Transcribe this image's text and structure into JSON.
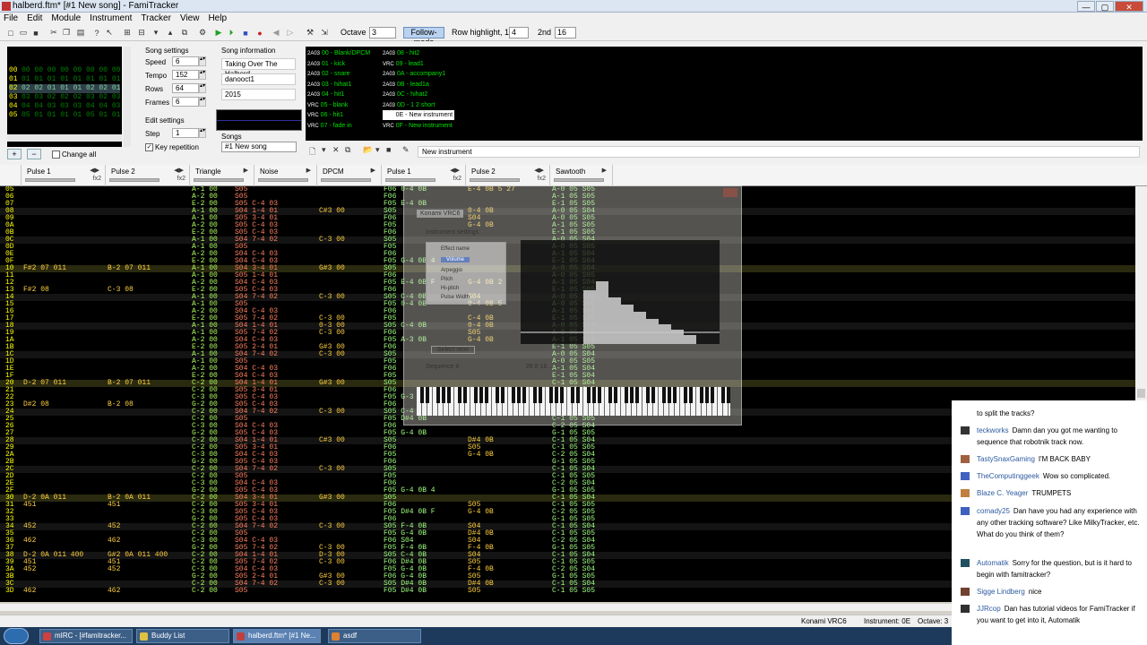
{
  "window": {
    "title": "halberd.ftm* [#1 New song] - FamiTracker"
  },
  "menu": [
    "File",
    "Edit",
    "Module",
    "Instrument",
    "Tracker",
    "View",
    "Help"
  ],
  "toolbar": {
    "octave_label": "Octave",
    "octave_value": "3",
    "follow_mode": "Follow-mode",
    "row_highlight_label": "Row highlight, 1st",
    "row_highlight_1st": "4",
    "second_label": "2nd",
    "row_highlight_2nd": "16"
  },
  "frames": {
    "rows": [
      {
        "n": "00",
        "v": "00 00 00 00 00 00 00 00"
      },
      {
        "n": "01",
        "v": "01 01 01 01 01 01 01 01"
      },
      {
        "n": "02",
        "v": "02 02 01 01 01 02 02 01"
      },
      {
        "n": "03",
        "v": "03 03 02 02 02 03 02 03"
      },
      {
        "n": "04",
        "v": "04 04 03 03 03 04 04 03"
      },
      {
        "n": "05",
        "v": "05 01 01 01 01 05 01 01"
      }
    ],
    "current": 2
  },
  "song_settings": {
    "title": "Song settings",
    "speed_label": "Speed",
    "speed": "6",
    "tempo_label": "Tempo",
    "tempo": "152",
    "rows_label": "Rows",
    "rows": "64",
    "frames_label": "Frames",
    "frames": "6"
  },
  "edit_settings": {
    "title": "Edit settings",
    "step_label": "Step",
    "step": "1",
    "key_repetition": "Key repetition"
  },
  "song_info": {
    "title": "Song information",
    "name": "Taking Over The Halberd",
    "artist": "danooct1",
    "copyright": "2015"
  },
  "songs": {
    "label": "Songs",
    "selected": "#1 New song"
  },
  "instruments": [
    {
      "name": "00 - Blank/DPCM",
      "vrc": false
    },
    {
      "name": "01 - kick",
      "vrc": false
    },
    {
      "name": "02 - snare",
      "vrc": false
    },
    {
      "name": "03 - hihat1",
      "vrc": false
    },
    {
      "name": "04 - hit1",
      "vrc": false
    },
    {
      "name": "05 - blank",
      "vrc": true
    },
    {
      "name": "06 - hit1",
      "vrc": true
    },
    {
      "name": "07 - fade in",
      "vrc": true
    },
    {
      "name": "08 - hit2",
      "vrc": false
    },
    {
      "name": "09 - lead1",
      "vrc": true
    },
    {
      "name": "0A - accompany1",
      "vrc": false
    },
    {
      "name": "0B - lead1a",
      "vrc": false
    },
    {
      "name": "0C - hihat2",
      "vrc": false
    },
    {
      "name": "0D - 1 2 short",
      "vrc": false
    },
    {
      "name": "0E - New instrument",
      "vrc": true,
      "selected": true
    },
    {
      "name": "0F - New instrument",
      "vrc": true
    }
  ],
  "instrument_name_field": "New instrument",
  "change_all": "Change all",
  "channels": [
    {
      "name": "Pulse 1",
      "fx": "fx2"
    },
    {
      "name": "Pulse 2",
      "fx": "fx2"
    },
    {
      "name": "Triangle",
      "fx": ""
    },
    {
      "name": "Noise",
      "fx": ""
    },
    {
      "name": "DPCM",
      "fx": ""
    },
    {
      "name": "Pulse 1",
      "fx": "fx2"
    },
    {
      "name": "Pulse 2",
      "fx": "fx2"
    },
    {
      "name": "Sawtooth",
      "fx": ""
    }
  ],
  "pattern_rows": [
    {
      "r": "05",
      "c": [
        "",
        "",
        "A-1 00",
        "S05",
        "",
        "F06 0-4 0B",
        "E-4 0B 5 27",
        "A-0 05 S05"
      ]
    },
    {
      "r": "06",
      "c": [
        "",
        "",
        "A-2 00",
        "S05",
        "",
        "F06",
        "",
        "A-1 05 S05"
      ]
    },
    {
      "r": "07",
      "c": [
        "",
        "",
        "E-2 00",
        "S05 C-4 03",
        "",
        "F05 E-4 0B",
        "",
        "E-1 05 S05"
      ]
    },
    {
      "r": "08",
      "c": [
        "",
        "",
        "A-1 00",
        "S04 1-4 01",
        "C#3 00",
        "S05",
        "0-4 0B",
        "A-0 05 S04"
      ]
    },
    {
      "r": "09",
      "c": [
        "",
        "",
        "A-1 00",
        "S05 3-4 01",
        "",
        "F06",
        "S04",
        "A-0 05 S05"
      ]
    },
    {
      "r": "0A",
      "c": [
        "",
        "",
        "A-2 00",
        "S05 C-4 03",
        "",
        "F05",
        "G-4 0B",
        "A-1 05 S05"
      ]
    },
    {
      "r": "0B",
      "c": [
        "",
        "",
        "E-2 00",
        "S05 C-4 03",
        "",
        "F06",
        "",
        "E-1 05 S05"
      ]
    },
    {
      "r": "0C",
      "c": [
        "",
        "",
        "A-1 00",
        "S04 7-4 02",
        "C-3 00",
        "S05",
        "",
        "A-0 05 S04"
      ]
    },
    {
      "r": "0D",
      "c": [
        "",
        "",
        "A-1 00",
        "S05",
        "",
        "F05",
        "",
        "A-0 05 S05"
      ]
    },
    {
      "r": "0E",
      "c": [
        "",
        "",
        "A-2 00",
        "S04 C-4 03",
        "",
        "F06",
        "",
        "A-1 05 S04"
      ]
    },
    {
      "r": "0F",
      "c": [
        "",
        "",
        "E-2 00",
        "S04 C-4 03",
        "",
        "F05 G-4 0B 4",
        "",
        "E-1 05 S04"
      ]
    },
    {
      "r": "10",
      "c": [
        "F#2 07 011",
        "B-2 07 011",
        "A-1 00",
        "S04 3-4 01",
        "G#3 00",
        "S05",
        "",
        "A-0 05 S04"
      ]
    },
    {
      "r": "11",
      "c": [
        "",
        "",
        "A-1 00",
        "S05 1-4 01",
        "",
        "F06",
        "",
        "A-0 05 S05"
      ]
    },
    {
      "r": "12",
      "c": [
        "",
        "",
        "A-2 00",
        "S04 C-4 03",
        "",
        "F05 E-4 0B F",
        "G-4 0B 2",
        "A-1 05 S04"
      ]
    },
    {
      "r": "13",
      "c": [
        "F#2 08",
        "C-3 08",
        "E-2 00",
        "S05 C-4 03",
        "",
        "F06",
        "",
        "E-1 05 S05"
      ]
    },
    {
      "r": "14",
      "c": [
        "",
        "",
        "A-1 00",
        "S04 7-4 02",
        "C-3 00",
        "S05 C-4 0B",
        "S04",
        "A-0 05 S04"
      ]
    },
    {
      "r": "15",
      "c": [
        "",
        "",
        "A-1 00",
        "S05",
        "",
        "F05 0-4 0B",
        "0-4 0B 5",
        "A-0 05 S05"
      ]
    },
    {
      "r": "16",
      "c": [
        "",
        "",
        "A-2 00",
        "S04 C-4 03",
        "",
        "F06",
        "",
        "A-1 05 S04"
      ]
    },
    {
      "r": "17",
      "c": [
        "",
        "",
        "E-2 00",
        "S05 7-4 02",
        "C-3 00",
        "F05",
        "C-4 0B",
        "E-1 05 S05"
      ]
    },
    {
      "r": "18",
      "c": [
        "",
        "",
        "A-1 00",
        "S04 1-4 01",
        "0-3 00",
        "S05 C-4 0B",
        "0-4 0B",
        "A-0 05 S04"
      ]
    },
    {
      "r": "19",
      "c": [
        "",
        "",
        "A-1 00",
        "S05 7-4 02",
        "C-3 00",
        "F06",
        "S05",
        "A-0 05 S05"
      ]
    },
    {
      "r": "1A",
      "c": [
        "",
        "",
        "A-2 00",
        "S04 C-4 03",
        "",
        "F05 A-3 0B",
        "G-4 0B",
        "A-1 05 S04"
      ]
    },
    {
      "r": "1B",
      "c": [
        "",
        "",
        "E-2 00",
        "S05 2-4 01",
        "G#3 00",
        "F06",
        "",
        "E-1 05 S05"
      ]
    },
    {
      "r": "1C",
      "c": [
        "",
        "",
        "A-1 00",
        "S04 7-4 02",
        "C-3 00",
        "S05",
        "",
        "A-0 05 S04"
      ]
    },
    {
      "r": "1D",
      "c": [
        "",
        "",
        "A-1 00",
        "S05",
        "",
        "F05",
        "",
        "A-0 05 S05"
      ]
    },
    {
      "r": "1E",
      "c": [
        "",
        "",
        "A-2 00",
        "S04 C-4 03",
        "",
        "F06",
        "",
        "A-1 05 S04"
      ]
    },
    {
      "r": "1F",
      "c": [
        "",
        "",
        "E-2 00",
        "S04 C-4 03",
        "",
        "F05",
        "",
        "E-1 05 S04"
      ]
    },
    {
      "r": "20",
      "c": [
        "D-2 07 011",
        "B-2 07 011",
        "C-2 00",
        "S04 1-4 01",
        "G#3 00",
        "S05",
        "",
        "C-1 05 S04"
      ]
    },
    {
      "r": "21",
      "c": [
        "",
        "",
        "C-2 00",
        "S05 3-4 01",
        "",
        "F06",
        "",
        "C-1 05 S05"
      ]
    },
    {
      "r": "22",
      "c": [
        "",
        "",
        "C-3 00",
        "S05 C-4 03",
        "",
        "F05 G-3 0B",
        "",
        "C-2 05 S05"
      ]
    },
    {
      "r": "23",
      "c": [
        "D#2 08",
        "B-2 08",
        "G-2 00",
        "S05 C-4 03",
        "",
        "F06",
        "",
        "G-1 05 S05"
      ]
    },
    {
      "r": "24",
      "c": [
        "",
        "",
        "C-2 00",
        "S04 7-4 02",
        "C-3 00",
        "S05 C-4 0B",
        "",
        "C-1 05 S04"
      ]
    },
    {
      "r": "25",
      "c": [
        "",
        "",
        "C-2 00",
        "S05",
        "",
        "F05 D#4 0B",
        "",
        "C-1 05 S05"
      ]
    },
    {
      "r": "26",
      "c": [
        "",
        "",
        "C-3 00",
        "S04 C-4 03",
        "",
        "F06",
        "",
        "C-2 05 S04"
      ]
    },
    {
      "r": "27",
      "c": [
        "",
        "",
        "G-2 00",
        "S05 C-4 03",
        "",
        "F05 G-4 0B",
        "",
        "G-1 05 S05"
      ]
    },
    {
      "r": "28",
      "c": [
        "",
        "",
        "C-2 00",
        "S04 1-4 01",
        "C#3 00",
        "S05",
        "D#4 0B",
        "C-1 05 S04"
      ]
    },
    {
      "r": "29",
      "c": [
        "",
        "",
        "C-2 00",
        "S05 3-4 01",
        "",
        "F06",
        "S05",
        "C-1 05 S05"
      ]
    },
    {
      "r": "2A",
      "c": [
        "",
        "",
        "C-3 00",
        "S04 C-4 03",
        "",
        "F05",
        "G-4 0B",
        "C-2 05 S04"
      ]
    },
    {
      "r": "2B",
      "c": [
        "",
        "",
        "G-2 00",
        "S05 C-4 03",
        "",
        "F06",
        "",
        "G-1 05 S05"
      ]
    },
    {
      "r": "2C",
      "c": [
        "",
        "",
        "C-2 00",
        "S04 7-4 02",
        "C-3 00",
        "S05",
        "",
        "C-1 05 S04"
      ]
    },
    {
      "r": "2D",
      "c": [
        "",
        "",
        "C-2 00",
        "S05",
        "",
        "F05",
        "",
        "C-1 05 S05"
      ]
    },
    {
      "r": "2E",
      "c": [
        "",
        "",
        "C-3 00",
        "S04 C-4 03",
        "",
        "F06",
        "",
        "C-2 05 S04"
      ]
    },
    {
      "r": "2F",
      "c": [
        "",
        "",
        "G-2 00",
        "S05 C-4 03",
        "",
        "F05 G-4 0B 4",
        "",
        "G-1 05 S05"
      ]
    },
    {
      "r": "30",
      "c": [
        "D-2 0A 011",
        "B-2 0A 011",
        "C-2 00",
        "S04 3-4 01",
        "G#3 00",
        "S05",
        "",
        "C-1 05 S04"
      ]
    },
    {
      "r": "31",
      "c": [
        "451",
        "451",
        "C-2 00",
        "S05 3-4 01",
        "",
        "F06",
        "S05",
        "C-1 05 S05"
      ]
    },
    {
      "r": "32",
      "c": [
        "",
        "",
        "C-3 00",
        "S05 C-4 03",
        "",
        "F05 D#4 0B F",
        "G-4 0B",
        "C-2 05 S05"
      ]
    },
    {
      "r": "33",
      "c": [
        "",
        "",
        "G-2 00",
        "S05 C-4 03",
        "",
        "F06",
        "",
        "G-1 05 S05"
      ]
    },
    {
      "r": "34",
      "c": [
        "452",
        "452",
        "C-2 00",
        "S04 7-4 02",
        "C-3 00",
        "S05 F-4 0B",
        "S04",
        "C-1 05 S04"
      ]
    },
    {
      "r": "35",
      "c": [
        "",
        "",
        "C-2 00",
        "S05",
        "",
        "F05 G-4 0B",
        "D#4 0B",
        "C-1 05 S05"
      ]
    },
    {
      "r": "36",
      "c": [
        "462",
        "462",
        "C-3 00",
        "S04 C-4 03",
        "",
        "F06 S04",
        "S04",
        "C-2 05 S04"
      ]
    },
    {
      "r": "37",
      "c": [
        "",
        "",
        "G-2 00",
        "S05 7-4 02",
        "C-3 00",
        "F05 F-4 0B",
        "F-4 0B",
        "G-1 05 S05"
      ]
    },
    {
      "r": "38",
      "c": [
        "D-2 0A 011 400",
        "G#2 0A 011 400",
        "C-2 00",
        "S04 1-4 01",
        "D-3 00",
        "S05 C-4 0B",
        "S04",
        "C-1 05 S04"
      ]
    },
    {
      "r": "39",
      "c": [
        "451",
        "451",
        "C-2 00",
        "S05 7-4 02",
        "C-3 00",
        "F06 D#4 0B",
        "S05",
        "C-1 05 S05"
      ]
    },
    {
      "r": "3A",
      "c": [
        "452",
        "452",
        "C-3 00",
        "S04 C-4 03",
        "",
        "F05 G-4 0B",
        "F-4 0B",
        "C-2 05 S04"
      ]
    },
    {
      "r": "3B",
      "c": [
        "",
        "",
        "G-2 00",
        "S05 2-4 01",
        "G#3 00",
        "F06 G-4 0B",
        "S05",
        "G-1 05 S05"
      ]
    },
    {
      "r": "3C",
      "c": [
        "",
        "",
        "C-2 00",
        "S04 7-4 02",
        "C-3 00",
        "S05 D#4 0B",
        "D#4 0B",
        "C-1 05 S04"
      ]
    },
    {
      "r": "3D",
      "c": [
        "462",
        "462",
        "C-2 00",
        "S05",
        "",
        "F05 D#4 0B",
        "S05",
        "C-1 05 S05"
      ]
    }
  ],
  "instrument_editor": {
    "title": "Instrument editor",
    "tab": "Konami VRC6",
    "settings_label": "Instrument settings",
    "list": [
      "Effect name",
      "Volume",
      "Arpeggio",
      "Pitch",
      "Hi-pitch",
      "Pulse Width"
    ],
    "select_label": "Select next",
    "sequence_label": "Sequence #",
    "sequence_values": "26 8 16 ..."
  },
  "status": {
    "chip": "Konami VRC6",
    "instrument": "Instrument: 0E",
    "octave": "Octave: 3"
  },
  "taskbar": [
    {
      "label": "mIRC - [#famitracker...",
      "color": "#d04040"
    },
    {
      "label": "Buddy List",
      "color": "#e0c040"
    },
    {
      "label": "halberd.ftm* [#1 Ne...",
      "color": "#c04040"
    },
    {
      "label": "asdf",
      "color": "#e08030"
    }
  ],
  "chat": [
    {
      "user": "",
      "text": "to split the tracks?"
    },
    {
      "user": "teckworks",
      "text": "Damn dan you got me wanting to sequence that robotnik track now."
    },
    {
      "user": "TastySnaxGaming",
      "text": "I'M BACK BABY"
    },
    {
      "user": "TheComputinggeek",
      "text": "Wow so complicated."
    },
    {
      "user": "Blaze C. Yeager",
      "text": "TRUMPETS"
    },
    {
      "user": "comady25",
      "text": "Dan have you had any experience with any other tracking software? Like MilkyTracker, etc. What do you think of them?"
    },
    {
      "user": "Automatik",
      "text": "Sorry for the question, but is it hard to begin with famitracker?"
    },
    {
      "user": "Sigge Lindberg",
      "text": "nice"
    },
    {
      "user": "JJRcop",
      "text": "Dan has tutorial videos for FamiTracker if you want to get into it, Automatik"
    }
  ]
}
